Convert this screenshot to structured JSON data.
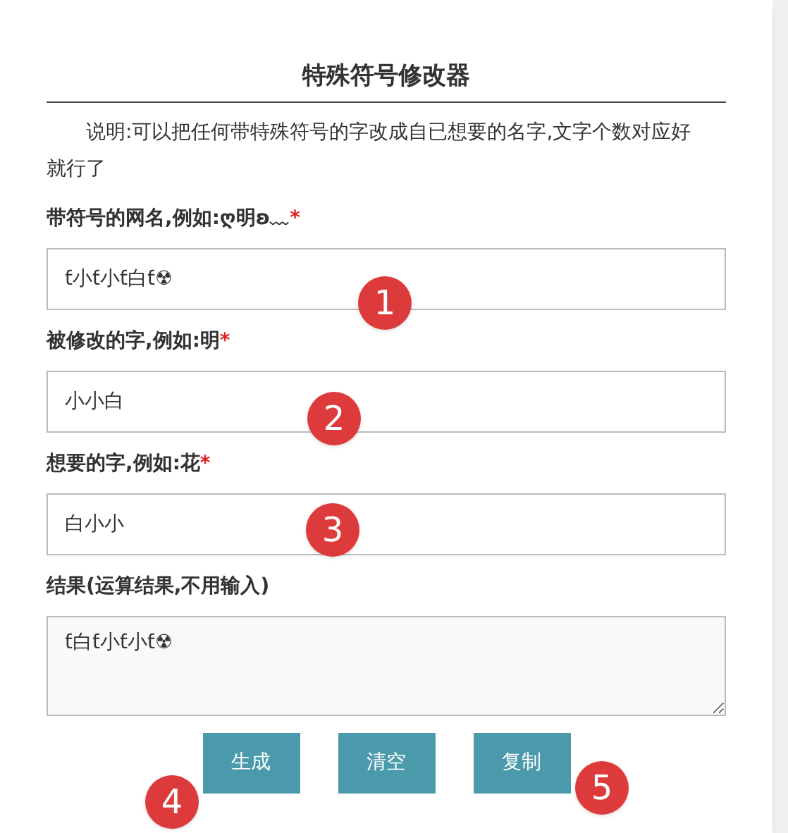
{
  "title": "特殊符号修改器",
  "description": "说明:可以把任何带特殊符号的字改成自已想要的名字,文字个数对应好就行了",
  "fields": [
    {
      "kind": "input",
      "label": "带符号的网名,例如:ღ明ʚ﹏",
      "required": "*",
      "value": "ƭ小ƭ小ƭ白ƭ☢"
    },
    {
      "kind": "input",
      "label": "被修改的字,例如:明",
      "required": "*",
      "value": "小小白"
    },
    {
      "kind": "input",
      "label": "想要的字,例如:花",
      "required": "*",
      "value": "白小小"
    },
    {
      "kind": "textarea",
      "label": "结果(运算结果,不用输入)",
      "value": "ƭ白ƭ小ƭ小ƭ☢"
    }
  ],
  "buttons": [
    "生成",
    "清空",
    "复制"
  ],
  "markers": [
    {
      "label": "1"
    },
    {
      "label": "2"
    },
    {
      "label": "3"
    },
    {
      "label": "4"
    },
    {
      "label": "5"
    }
  ]
}
